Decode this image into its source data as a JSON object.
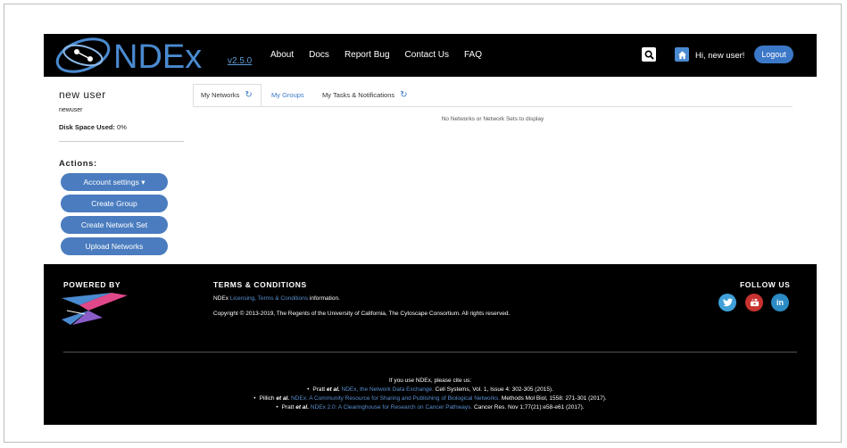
{
  "nav": {
    "logo_text": "NDEx",
    "version": "v2.5.0",
    "links": [
      "About",
      "Docs",
      "Report Bug",
      "Contact Us",
      "FAQ"
    ],
    "greeting": "Hi, new user!",
    "logout": "Logout"
  },
  "sidebar": {
    "name": "new user",
    "username": "newuser",
    "disk_label": "Disk Space Used:",
    "disk_value": "0%",
    "actions_label": "Actions:",
    "buttons": [
      "Account settings ▾",
      "Create Group",
      "Create Network Set",
      "Upload Networks"
    ]
  },
  "tabs": {
    "items": [
      "My Networks",
      "My Groups",
      "My Tasks & Notifications"
    ],
    "active": "My Networks",
    "empty_message": "No Networks or Network Sets to display"
  },
  "footer": {
    "powered_by": "POWERED BY",
    "terms_heading": "TERMS & CONDITIONS",
    "terms_prefix": "NDEx",
    "terms_link": "Licensing, Terms & Conditions",
    "terms_suffix": "information.",
    "copyright": "Copyright © 2013-2019, The Regents of the University of California, The Cytoscape Consortium. All rights reserved.",
    "follow_us": "FOLLOW US",
    "social_icons": [
      "twitter-icon",
      "youtube-icon",
      "linkedin-icon"
    ],
    "cite_intro": "If you use NDEx, please cite us:",
    "citations": [
      {
        "authors": "Pratt",
        "etal": "et al.",
        "title": "NDEx, the Network Data Exchange.",
        "ref": "Cell Systems, Vol. 1, Issue 4: 302-305 (2015)."
      },
      {
        "authors": "Pillich",
        "etal": "et al.",
        "title": "NDEx: A Community Resource for Sharing and Publishing of Biological Networks.",
        "ref": "Methods Mol Biol, 1558: 271-301 (2017)."
      },
      {
        "authors": "Pratt",
        "etal": "et al.",
        "title": "NDEx 2.0: A Clearinghouse for Research on Cancer Pathways.",
        "ref": "Cancer Res. Nov 1;77(21):e58-e61 (2017)."
      }
    ]
  },
  "colors": {
    "navbar": "#000000",
    "button_blue": "#4a7cbf",
    "link_blue": "#5a8fd0",
    "twitter": "#3fa1d8",
    "youtube": "#c8332f",
    "linkedin": "#2b8bc4"
  }
}
